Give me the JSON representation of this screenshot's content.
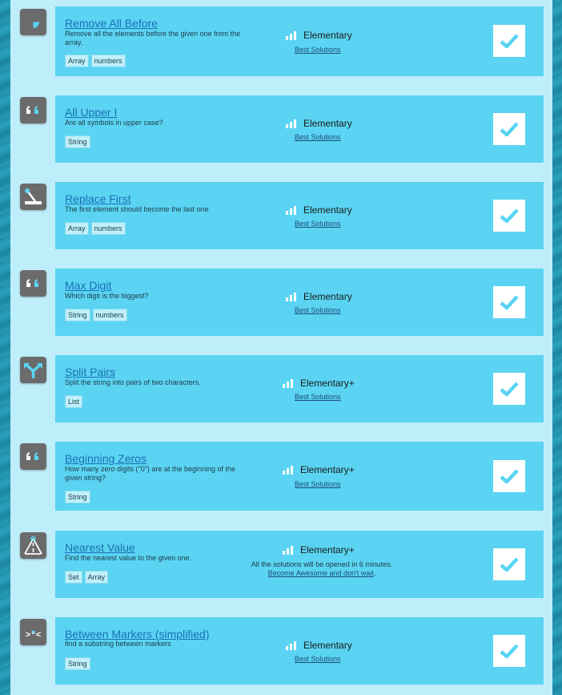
{
  "level_labels": {
    "elementary": "Elementary",
    "elementary_plus": "Elementary+"
  },
  "best_label": "Best Solutions",
  "check_icon": "checkmark-icon",
  "missions": [
    {
      "title": "Remove All Before",
      "desc": "Remove all the elements before the given one from the array.",
      "tags": [
        "Array",
        "numbers"
      ],
      "level": "Elementary",
      "icon": "pacman-icon"
    },
    {
      "title": "All Upper I",
      "desc": "Are all symbols in upper case?",
      "tags": [
        "String"
      ],
      "level": "Elementary",
      "icon": "quote-icon"
    },
    {
      "title": "Replace First",
      "desc": "The first element should become the last one",
      "tags": [
        "Array",
        "numbers"
      ],
      "level": "Elementary",
      "icon": "lever-icon"
    },
    {
      "title": "Max Digit",
      "desc": "Which digit is the biggest?",
      "tags": [
        "String",
        "numbers"
      ],
      "level": "Elementary",
      "icon": "quote-icon"
    },
    {
      "title": "Split Pairs",
      "desc": "Split the string into pairs of two characters.",
      "tags": [
        "List"
      ],
      "level": "Elementary+",
      "icon": "fork-arrow-icon"
    },
    {
      "title": "Beginning Zeros",
      "desc": "How many zero digits (\"0\") are at the beginning of the given string?",
      "tags": [
        "String"
      ],
      "level": "Elementary+",
      "icon": "quote-icon"
    },
    {
      "title": "Nearest Value",
      "desc": "Find the nearest value to the given one.",
      "tags": [
        "Set",
        "Array"
      ],
      "level": "Elementary+",
      "icon": "road-icon",
      "notice_text": "All the solutions will be opened in 6 minutes.",
      "notice_link": "Become Awesome and don't wait"
    },
    {
      "title": "Between Markers (simplified)",
      "desc": "find a substring between markers",
      "tags": [
        "String"
      ],
      "level": "Elementary",
      "icon": "markers-icon"
    }
  ]
}
